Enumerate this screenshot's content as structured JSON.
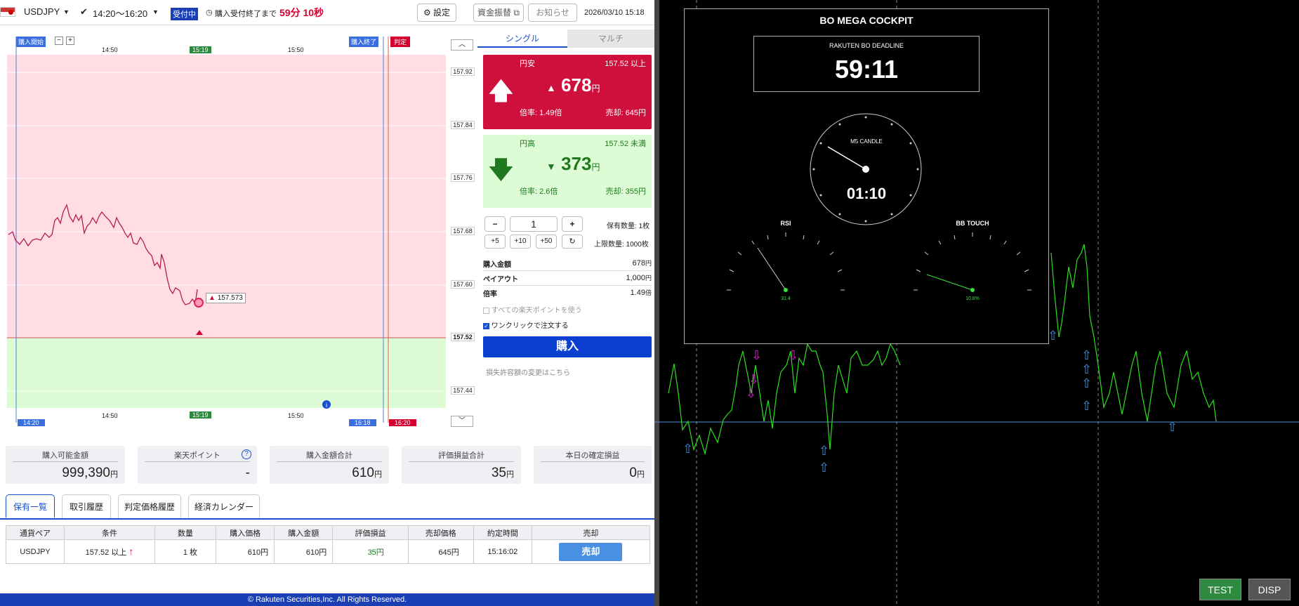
{
  "topbar": {
    "pair": "USDJPY",
    "session": "14:20〜16:20",
    "status_badge": "受付中",
    "deadline_label": "購入受付終了まで",
    "deadline_value": "59分 10秒",
    "settings": "設定",
    "transfer": "資金振替",
    "notice": "お知らせ",
    "datetime": "2026/03/10 15:18"
  },
  "chart": {
    "markers": {
      "start": "購入開始",
      "end": "購入終了",
      "judge": "判定"
    },
    "time_top": [
      "14:50",
      "15:19",
      "15:50"
    ],
    "time_bottom": [
      "14:20",
      "14:50",
      "15:19",
      "15:50",
      "16:18",
      "16:20"
    ],
    "price_ticks": [
      "157.92",
      "157.84",
      "157.76",
      "157.68",
      "157.60",
      "157.52",
      "157.44"
    ],
    "current_price": "157.573",
    "strike": "157.52",
    "zoom_out": "−",
    "zoom_in": "+"
  },
  "order": {
    "tabs": [
      "シングル",
      "マルチ"
    ],
    "up": {
      "name": "円安",
      "cond": "157.52 以上",
      "price": "678",
      "unit": "円",
      "rate": "倍率: 1.49倍",
      "sell": "売却: 645円"
    },
    "down": {
      "name": "円高",
      "cond": "157.52 未満",
      "price": "373",
      "unit": "円",
      "rate": "倍率: 2.6倍",
      "sell": "売却: 355円"
    },
    "qty": "1",
    "minus": "−",
    "plus": "+",
    "steps": [
      "+5",
      "+10",
      "+50"
    ],
    "hold": "保有数量: 1枚",
    "limit": "上限数量: 1000枚",
    "rows": [
      {
        "k": "購入金額",
        "v": "678",
        "u": "円"
      },
      {
        "k": "ペイアウト",
        "v": "1,000",
        "u": "円"
      },
      {
        "k": "倍率",
        "v": "1.49",
        "u": "倍"
      }
    ],
    "use_points": "すべての楽天ポイントを使う",
    "one_click": "ワンクリックで注文する",
    "buy": "購入",
    "loss_link": "損失許容額の変更はこちら"
  },
  "summary": [
    {
      "label": "購入可能金額",
      "value": "999,390",
      "unit": "円"
    },
    {
      "label": "楽天ポイント",
      "value": "-",
      "unit": ""
    },
    {
      "label": "購入金額合計",
      "value": "610",
      "unit": "円"
    },
    {
      "label": "評価損益合計",
      "value": "35",
      "unit": "円"
    },
    {
      "label": "本日の確定損益",
      "value": "0",
      "unit": "円"
    }
  ],
  "tabs": [
    "保有一覧",
    "取引履歴",
    "判定価格履歴",
    "経済カレンダー"
  ],
  "table": {
    "headers": [
      "通貨ペア",
      "条件",
      "数量",
      "購入価格",
      "購入金額",
      "評価損益",
      "売却価格",
      "約定時間",
      "売却"
    ],
    "row": {
      "pair": "USDJPY",
      "cond": "157.52 以上",
      "qty": "1 枚",
      "buy_price": "610円",
      "amount": "610円",
      "pl": "35円",
      "sell_price": "645円",
      "time": "15:16:02",
      "sell_btn": "売却"
    }
  },
  "footer": "© Rakuten Securities,Inc. All Rights Reserved.",
  "cockpit": {
    "title": "BO MEGA COCKPIT",
    "deadline_label": "RAKUTEN BO DEADLINE",
    "deadline": "59:11",
    "clock_label": "M5 CANDLE",
    "clock_time": "01:10",
    "rsi_label": "RSI",
    "rsi_value": "31.4",
    "bb_label": "BB TOUCH",
    "bb_value": "10.8%"
  },
  "buttons": {
    "test": "TEST",
    "disp": "DISP"
  }
}
